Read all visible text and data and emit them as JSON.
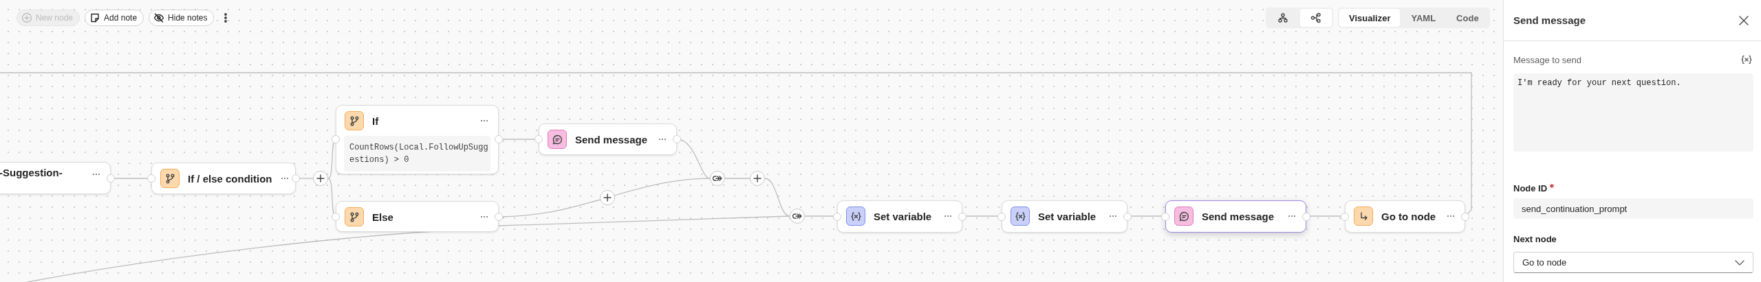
{
  "toolbar": {
    "buttons": [
      {
        "label": "New node",
        "kind": "plus",
        "disabled": true
      },
      {
        "label": "Add note",
        "kind": "note",
        "disabled": false
      },
      {
        "label": "Hide notes",
        "kind": "eye-off",
        "disabled": false
      }
    ]
  },
  "view_toggles": [
    {
      "kind": "tree",
      "selected": false
    },
    {
      "kind": "graph",
      "selected": true
    }
  ],
  "tabs": [
    {
      "label": "Visualizer",
      "selected": true
    },
    {
      "label": "YAML",
      "selected": false
    },
    {
      "label": "Code",
      "selected": false
    }
  ],
  "canvas": {
    "nodes": [
      {
        "title": "-Suggestion-",
        "selected": false
      },
      {
        "title": "If / else condition",
        "kind": "condition",
        "selected": false
      },
      {
        "title": "If",
        "kind": "condition",
        "selected": false,
        "code": "CountRows(Local.FollowUpSuggestions) > 0"
      },
      {
        "title": "Else",
        "kind": "condition",
        "selected": false
      },
      {
        "title": "Send message",
        "kind": "message",
        "selected": false
      },
      {
        "title": "Set variable",
        "kind": "variable",
        "selected": false
      },
      {
        "title": "Set variable",
        "kind": "variable",
        "selected": false
      },
      {
        "title": "Send message",
        "kind": "message",
        "selected": true
      },
      {
        "title": "Go to node",
        "kind": "goto",
        "selected": false
      }
    ]
  },
  "panel": {
    "title": "Send message",
    "fields": [
      {
        "kind": "textarea",
        "label": "Message to send",
        "required": false,
        "variable_insert": true,
        "value": "I'm ready for your next question."
      },
      {
        "kind": "text",
        "label": "Node ID",
        "required": true,
        "variable_insert": false,
        "value": "send_continuation_prompt"
      },
      {
        "kind": "select",
        "label": "Next node",
        "required": false,
        "variable_insert": false,
        "value": "Go to node"
      }
    ]
  }
}
